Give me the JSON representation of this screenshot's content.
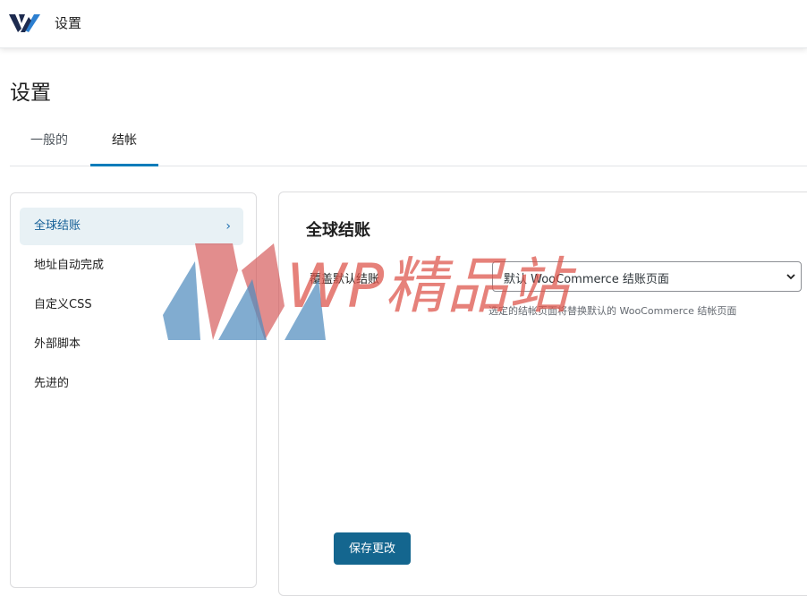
{
  "topbar": {
    "logo_icon": "brand-logo-icon",
    "title": "设置"
  },
  "page": {
    "title": "设置"
  },
  "tabs": [
    {
      "label": "一般的",
      "active": false
    },
    {
      "label": "结帐",
      "active": true
    }
  ],
  "sidebar": {
    "items": [
      {
        "label": "全球结账",
        "active": true,
        "icon": "chevron-right-icon"
      },
      {
        "label": "地址自动完成",
        "active": false
      },
      {
        "label": "自定义CSS",
        "active": false
      },
      {
        "label": "外部脚本",
        "active": false
      },
      {
        "label": "先进的",
        "active": false
      }
    ]
  },
  "panel": {
    "title": "全球结账",
    "override_field": {
      "label": "覆盖默认结账",
      "selected": "默认 WooCommerce 结账页面",
      "help": "选定的结帐页面将替换默认的 WooCommerce 结帐页面"
    },
    "save_label": "保存更改"
  },
  "watermark": {
    "text": "WP精品站"
  },
  "colors": {
    "accent": "#007cba",
    "primary_button": "#14668f",
    "active_item_bg": "#e8f1f5",
    "watermark_red": "#dc5046",
    "watermark_blue": "#5b97c3"
  }
}
